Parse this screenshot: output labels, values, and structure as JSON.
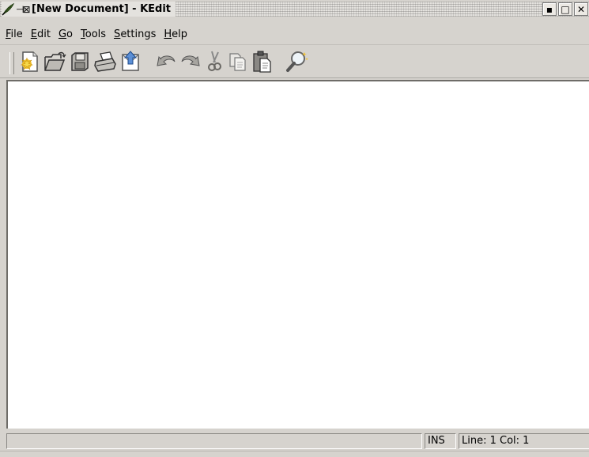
{
  "window": {
    "title": "[New Document] - KEdit",
    "pin_glyph": "⊣⊠",
    "app_icon": "kedit-feather-icon",
    "buttons": {
      "minimize": "▪",
      "maximize": "□",
      "close": "✕"
    }
  },
  "menubar": {
    "items": [
      {
        "accel": "F",
        "rest": "ile"
      },
      {
        "accel": "E",
        "rest": "dit"
      },
      {
        "accel": "G",
        "rest": "o"
      },
      {
        "accel": "T",
        "rest": "ools"
      },
      {
        "accel": "S",
        "rest": "ettings"
      },
      {
        "accel": "H",
        "rest": "elp"
      }
    ]
  },
  "toolbar": {
    "icons": [
      "new-document-icon",
      "open-folder-icon",
      "save-floppy-icon",
      "print-icon",
      "mail-send-icon",
      "undo-icon",
      "redo-icon",
      "cut-scissors-icon",
      "copy-icon",
      "paste-icon",
      "find-magnifier-icon"
    ]
  },
  "editor": {
    "content": ""
  },
  "statusbar": {
    "message": "",
    "mode": "INS",
    "position": "Line: 1 Col: 1"
  },
  "colors": {
    "chrome": "#d6d3ce",
    "editor_bg": "#ffffff",
    "icon_gray": "#8a8a8a",
    "icon_yellow": "#f2c12e"
  }
}
